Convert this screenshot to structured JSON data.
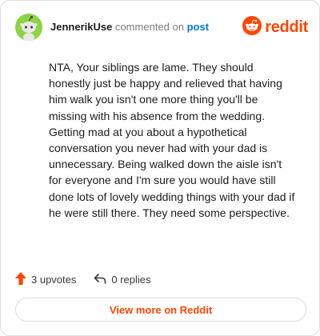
{
  "header": {
    "username": "JennerikUse",
    "commented_text": "commented on",
    "post_link": "post",
    "brand_name": "reddit",
    "avatar_icon": "snoo-avatar-icon",
    "brand_icon": "reddit-logo-icon"
  },
  "comment": {
    "text": "NTA, Your siblings are lame. They should honestly just be happy and relieved that having him walk you isn't one more thing you'll be missing with his absence from the wedding. Getting mad at you about a hypothetical conversation you never had with your dad is unnecessary. Being walked down the aisle isn't for everyone and I'm sure you would have still done lots of lovely wedding things with your dad if he were still there. They need some perspective."
  },
  "actions": {
    "upvotes_label": "3 upvotes",
    "replies_label": "0 replies",
    "upvote_icon": "upvote-arrow-icon",
    "reply_icon": "reply-arrow-icon"
  },
  "footer": {
    "view_more_label": "View more on Reddit"
  },
  "colors": {
    "brand": "#ff4500",
    "link": "#0079d3",
    "avatar_bg": "#8bd444",
    "border": "#dcdcdc",
    "text": "#1c1c1c",
    "muted": "#7c7c7c"
  }
}
